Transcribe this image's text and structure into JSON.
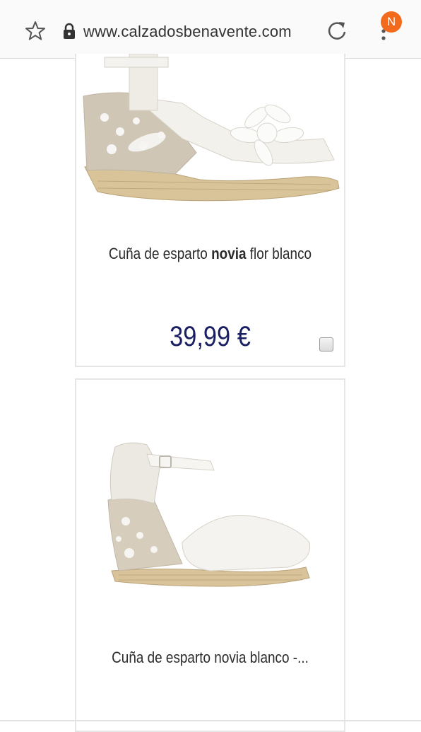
{
  "browser": {
    "url": "www.calzadosbenavente.com",
    "badge_letter": "N",
    "accent_color": "#f26b1d"
  },
  "icons": {
    "bookmark": "star-icon",
    "secure": "lock-icon",
    "reload": "reload-icon",
    "menu": "menu-icon"
  },
  "products": [
    {
      "name_parts": [
        "Cuña de esparto ",
        "novia",
        " flor blanco"
      ],
      "price": "39,99 €",
      "price_color": "#1a1f63"
    },
    {
      "name": "Cuña de esparto novia blanco -..."
    }
  ]
}
